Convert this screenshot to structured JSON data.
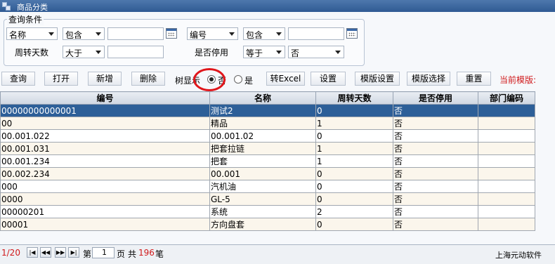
{
  "window": {
    "title": "商品分类"
  },
  "query": {
    "legend": "查询条件",
    "row1": {
      "field1": "名称",
      "op1": "包含",
      "value1": "",
      "field2": "编号",
      "op2": "包含",
      "value2": ""
    },
    "row2": {
      "label1": "周转天数",
      "op1": "大于",
      "value1": "",
      "label2": "是否停用",
      "op2": "等于",
      "value2": "否"
    }
  },
  "toolbar": {
    "query": "查询",
    "open": "打开",
    "add": "新增",
    "delete": "删除",
    "tree_label": "树显示",
    "radio_no": "否",
    "radio_yes": "是",
    "tree_selected": "否",
    "excel": "转Excel",
    "settings": "设置",
    "template_settings": "模版设置",
    "template_select": "模版选择",
    "reset": "重置",
    "current_template": "当前模版:"
  },
  "table": {
    "columns": [
      "编号",
      "名称",
      "周转天数",
      "是否停用",
      "部门编码"
    ],
    "rows": [
      [
        "00000000000001",
        "测试2",
        "0",
        "否",
        ""
      ],
      [
        "00",
        "精品",
        "1",
        "否",
        ""
      ],
      [
        "00.001.022",
        "00.001.02",
        "0",
        "否",
        ""
      ],
      [
        "00.001.031",
        "把套拉链",
        "1",
        "否",
        ""
      ],
      [
        "00.001.234",
        "把套",
        "1",
        "否",
        ""
      ],
      [
        "00.002.234",
        "00.001",
        "0",
        "否",
        ""
      ],
      [
        "000",
        "汽机油",
        "0",
        "否",
        ""
      ],
      [
        "0000",
        "GL-5",
        "0",
        "否",
        ""
      ],
      [
        "00000201",
        "系统",
        "2",
        "否",
        ""
      ],
      [
        "00001",
        "方向盘套",
        "0",
        "否",
        ""
      ]
    ]
  },
  "pager": {
    "pages": "1/20",
    "page_prefix": "第",
    "page_value": "1",
    "page_suffix": "页",
    "total_prefix": "共",
    "total": "196",
    "total_suffix": "笔"
  },
  "footer": {
    "company": "上海元动软件"
  },
  "colors": {
    "selected_row": "#2d5f98",
    "alt_row": "#fbf6ec",
    "accent_red": "#d0191b",
    "titlebar": "#2f5a93"
  }
}
